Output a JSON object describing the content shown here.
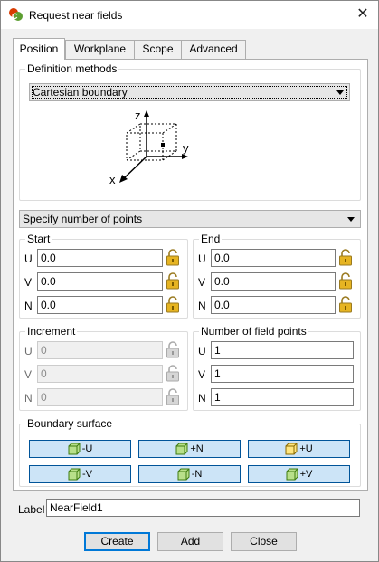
{
  "window": {
    "title": "Request near fields",
    "close_glyph": "✕"
  },
  "tabs": [
    {
      "label": "Position",
      "active": true
    },
    {
      "label": "Workplane",
      "active": false
    },
    {
      "label": "Scope",
      "active": false
    },
    {
      "label": "Advanced",
      "active": false
    }
  ],
  "definition": {
    "group_label": "Definition methods",
    "method": "Cartesian boundary",
    "axes": {
      "z": "z",
      "y": "y",
      "x": "x"
    }
  },
  "points_mode": "Specify number of points",
  "start": {
    "group_label": "Start",
    "rows": [
      {
        "label": "U",
        "value": "0.0"
      },
      {
        "label": "V",
        "value": "0.0"
      },
      {
        "label": "N",
        "value": "0.0"
      }
    ]
  },
  "end": {
    "group_label": "End",
    "rows": [
      {
        "label": "U",
        "value": "0.0"
      },
      {
        "label": "V",
        "value": "0.0"
      },
      {
        "label": "N",
        "value": "0.0"
      }
    ]
  },
  "increment": {
    "group_label": "Increment",
    "rows": [
      {
        "label": "U",
        "value": "0"
      },
      {
        "label": "V",
        "value": "0"
      },
      {
        "label": "N",
        "value": "0"
      }
    ]
  },
  "field_points": {
    "group_label": "Number of field points",
    "rows": [
      {
        "label": "U",
        "value": "1"
      },
      {
        "label": "V",
        "value": "1"
      },
      {
        "label": "N",
        "value": "1"
      }
    ]
  },
  "boundary": {
    "group_label": "Boundary surface",
    "buttons": [
      "-U",
      "+N",
      "+U",
      "-V",
      "-N",
      "+V"
    ]
  },
  "label_field": {
    "label": "Label",
    "value": "NearField1"
  },
  "footer": {
    "create": "Create",
    "add": "Add",
    "close": "Close"
  },
  "colors": {
    "accent": "#0078d7",
    "button_blue": "#cce4f7",
    "lock_gold": "#d9a200",
    "cube_green": "#7dc242"
  }
}
